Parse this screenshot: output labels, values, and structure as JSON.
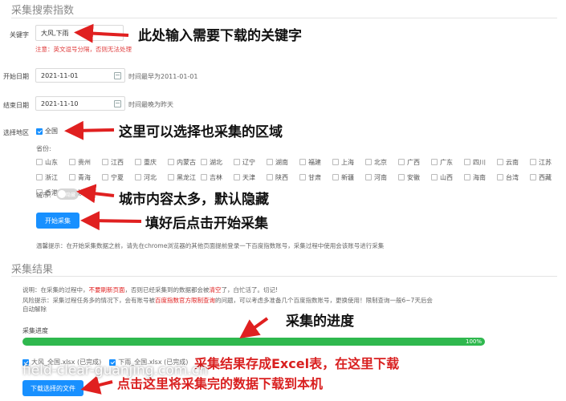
{
  "form": {
    "title": "采集搜索指数",
    "keyword_label": "关键字",
    "keyword_value": "大风,下雨",
    "keyword_note": "注意：英文逗号分隔，否则无法处理",
    "start_label": "开始日期",
    "start_value": "2021-11-01",
    "start_hint": "时间最早为2011-01-01",
    "end_label": "结束日期",
    "end_value": "2021-11-10",
    "end_hint": "时间最晚为昨天",
    "region_label": "选择地区",
    "nationwide_label": "全国",
    "province_label": "省份:",
    "provinces": [
      "山东",
      "贵州",
      "江西",
      "重庆",
      "内蒙古",
      "湖北",
      "辽宁",
      "湖南",
      "福建",
      "上海",
      "北京",
      "广西",
      "广东",
      "四川",
      "云南",
      "江苏",
      "浙江",
      "青海",
      "宁夏",
      "河北",
      "黑龙江",
      "吉林",
      "天津",
      "陕西",
      "甘肃",
      "新疆",
      "河南",
      "安徽",
      "山西",
      "海南",
      "台湾",
      "西藏",
      "香港",
      "澳门"
    ],
    "city_label": "城市:",
    "city_switch_text": "隐藏",
    "start_button": "开始采集",
    "tip": "温馨提示：在开始采集数据之前，请先在chrome浏览器的其他页面提前登录一下百度指数账号，采集过程中使用会该账号进行采集"
  },
  "results": {
    "title": "采集结果",
    "note1_a": "说明：在采集的过程中，",
    "note1_b": "不要刷新页面",
    "note1_c": "，否则已经采集到的数据都会被",
    "note1_d": "清空",
    "note1_e": "了，白忙活了。切记!",
    "note2_a": "风险提示：采集过程任务多的情况下，会有账号被",
    "note2_b": "百度指数官方限制查询",
    "note2_c": "的问题，可以考虑多准备几个百度指数账号，更换使用！限制查询一般6~7天后会",
    "note2_d": "自动解除",
    "progress_label": "采集进度",
    "progress_text": "100%",
    "progress_value": 1.0,
    "files": [
      {
        "label": "大风_全国.xlsx (已完成)"
      },
      {
        "label": "下雨_全国.xlsx (已完成)"
      }
    ],
    "download_button": "下载选择的文件"
  },
  "annotations": {
    "keyword": "此处输入需要下载的关键字",
    "region": "这里可以选择也采集的区域",
    "city": "城市内容太多，默认隐藏",
    "start": "填好后点击开始采集",
    "progress": "采集的进度",
    "excel": "采集结果存成Excel表，在这里下载",
    "download": "点击这里将采集完的数据下载到本机"
  },
  "watermark": "field-clear-guanjing.com.cn",
  "colors": {
    "primary": "#1890ff",
    "progress": "#2fb84e",
    "warning": "#e02020",
    "annotation_arrow": "#e02020"
  }
}
